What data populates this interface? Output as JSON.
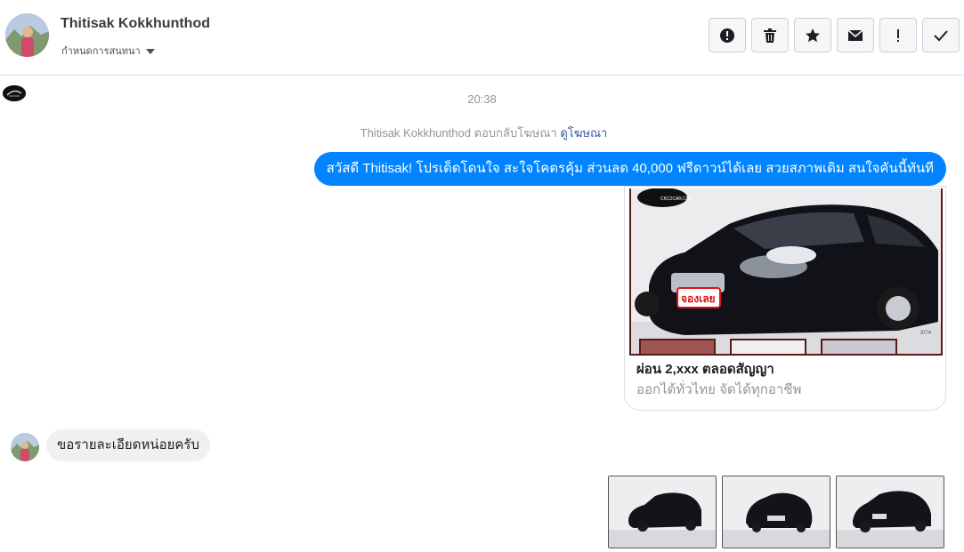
{
  "header": {
    "contact_name": "Thitisak Kokkhunthod",
    "assign_label": "กำหนดการสนทนา",
    "toolbar": [
      {
        "name": "report-button",
        "icon": "alert-circle-icon"
      },
      {
        "name": "delete-button",
        "icon": "trash-icon"
      },
      {
        "name": "star-button",
        "icon": "star-icon"
      },
      {
        "name": "unread-button",
        "icon": "envelope-icon"
      },
      {
        "name": "follow-up-button",
        "icon": "exclamation-icon"
      },
      {
        "name": "mark-done-button",
        "icon": "check-icon"
      }
    ]
  },
  "thread": {
    "timestamp": "20:38",
    "ad_reply_text": "Thitisak Kokkhunthod ตอบกลับโฆษณา",
    "ad_reply_link": "ดูโฆษณา",
    "outgoing_message": "สวัสดี Thitisak! โปรเด็ดโดนใจ สะใจโคตรคุ้ม ส่วนลด 40,000 ฟรีดาวน์ได้เลย สวยสภาพเดิม สนใจคันนี้ทันที",
    "ad_card": {
      "title": "ผ่อน 2,xxx ตลอดสัญญา",
      "description": "ออกได้ทั่วไทย จัดได้ทุกอาชีพ",
      "image": {
        "watermark": "CKC2CAR.COM",
        "stamp": "จองเลย",
        "code": "J074"
      }
    },
    "incoming_message": "ขอรายละเอียดหน่อยครับ",
    "photo_count": 3
  },
  "colors": {
    "accent": "#0084ff",
    "link": "#385898",
    "muted": "#90949c",
    "bubble_in": "#f1f0f0"
  }
}
